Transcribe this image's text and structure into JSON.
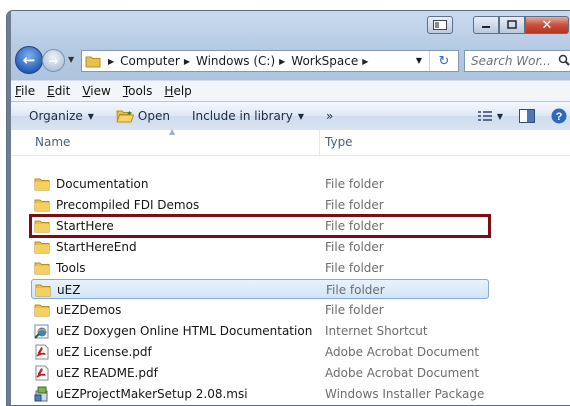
{
  "window": {
    "controls": {
      "minimize": "–",
      "maximize": "□",
      "close": "✕"
    }
  },
  "nav": {
    "breadcrumb": [
      "Computer",
      "Windows (C:)",
      "WorkSpace"
    ],
    "search_placeholder": "Search Wor..."
  },
  "menu": [
    {
      "pre": "",
      "key": "F",
      "post": "ile"
    },
    {
      "pre": "",
      "key": "E",
      "post": "dit"
    },
    {
      "pre": "",
      "key": "V",
      "post": "iew"
    },
    {
      "pre": "",
      "key": "T",
      "post": "ools"
    },
    {
      "pre": "",
      "key": "H",
      "post": "elp"
    }
  ],
  "toolbar": {
    "organize": "Organize",
    "open": "Open",
    "include_in_library": "Include in library",
    "more": "»"
  },
  "columns": {
    "name": "Name",
    "type": "Type"
  },
  "files": [
    {
      "name": "Documentation",
      "type": "File folder",
      "icon": "folder-icon"
    },
    {
      "name": "Precompiled FDI Demos",
      "type": "File folder",
      "icon": "folder-icon"
    },
    {
      "name": "StartHere",
      "type": "File folder",
      "icon": "folder-icon",
      "state": "highlighted"
    },
    {
      "name": "StartHereEnd",
      "type": "File folder",
      "icon": "folder-icon"
    },
    {
      "name": "Tools",
      "type": "File folder",
      "icon": "folder-icon"
    },
    {
      "name": "uEZ",
      "type": "File folder",
      "icon": "folder-icon",
      "state": "selected"
    },
    {
      "name": "uEZDemos",
      "type": "File folder",
      "icon": "folder-icon"
    },
    {
      "name": "uEZ Doxygen Online HTML Documentation",
      "type": "Internet Shortcut",
      "icon": "internet-shortcut-icon"
    },
    {
      "name": "uEZ License.pdf",
      "type": "Adobe Acrobat Document",
      "icon": "pdf-icon"
    },
    {
      "name": "uEZ README.pdf",
      "type": "Adobe Acrobat Document",
      "icon": "pdf-icon"
    },
    {
      "name": "uEZProjectMakerSetup 2.08.msi",
      "type": "Windows Installer Package",
      "icon": "installer-icon"
    }
  ],
  "colors": {
    "highlight_box": "#7a1014",
    "selection_bg": "#d2e5fa",
    "selection_border": "#84acdd"
  }
}
